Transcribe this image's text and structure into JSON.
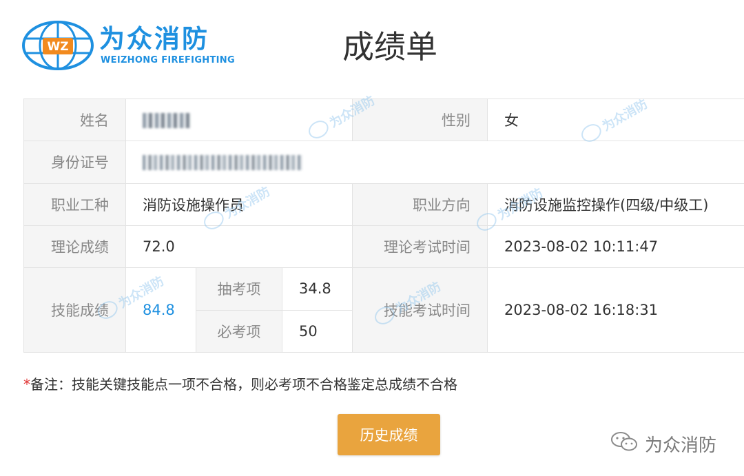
{
  "logo": {
    "initials": "WZ",
    "name_cn": "为众消防",
    "name_en": "WEIZHONG FIREFIGHTING"
  },
  "title": "成绩单",
  "watermark_text": "为众消防",
  "table": {
    "name_label": "姓名",
    "name_value": "",
    "gender_label": "性别",
    "gender_value": "女",
    "id_label": "身份证号",
    "id_value": "",
    "occupation_label": "职业工种",
    "occupation_value": "消防设施操作员",
    "direction_label": "职业方向",
    "direction_value": "消防设施监控操作(四级/中级工)",
    "theory_score_label": "理论成绩",
    "theory_score_value": "72.0",
    "theory_time_label": "理论考试时间",
    "theory_time_value": "2023-08-02 10:11:47",
    "skill_score_label": "技能成绩",
    "skill_score_value": "84.8",
    "skill_time_label": "技能考试时间",
    "skill_time_value": "2023-08-02 16:18:31",
    "sub_items": [
      {
        "label": "抽考项",
        "value": "34.8"
      },
      {
        "label": "必考项",
        "value": "50"
      }
    ]
  },
  "note": {
    "marker": "*",
    "text": "备注：技能关键技能点一项不合格，则必考项不合格鉴定总成绩不合格"
  },
  "history_button_label": "历史成绩",
  "footer": {
    "account_name": "为众消防",
    "icon": "wechat-icon"
  },
  "colors": {
    "brand_blue": "#1e90e0",
    "logo_orange": "#f28a1e",
    "button_orange": "#e9a43e",
    "note_star_red": "#e03030"
  }
}
